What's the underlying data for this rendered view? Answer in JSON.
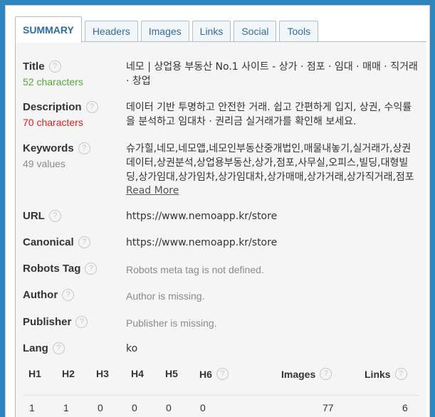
{
  "tabs": [
    "SUMMARY",
    "Headers",
    "Images",
    "Links",
    "Social",
    "Tools"
  ],
  "help_glyph": "?",
  "title": {
    "label": "Title",
    "sub": "52 characters",
    "value": "네모 | 상업용 부동산 No.1 사이트 - 상가 · 점포 · 임대 · 매매 · 직거래 · 창업"
  },
  "description": {
    "label": "Description",
    "sub": "70 characters",
    "value": "데이터 기반 투명하고 안전한 거래. 쉽고 간편하게 입지, 상권, 수익률을 분석하고 임대차 · 권리금 실거래가를 확인해 보세요."
  },
  "keywords": {
    "label": "Keywords",
    "sub": "49 values",
    "value": "슈가힐,네모,네모앱,네모인부동산중개법인,매물내놓기,실거래가,상권데이터,상권분석,상업용부동산,상가,점포,사무실,오피스,빌딩,대형빌딩,상가임대,상가임차,상가임대차,상가매매,상가거래,상가직거래,점포",
    "read_more": "Read More"
  },
  "url": {
    "label": "URL",
    "value": "https://www.nemoapp.kr/store"
  },
  "canonical": {
    "label": "Canonical",
    "value": "https://www.nemoapp.kr/store"
  },
  "robots": {
    "label": "Robots Tag",
    "value": "Robots meta tag is not defined."
  },
  "author": {
    "label": "Author",
    "value": "Author is missing."
  },
  "publisher": {
    "label": "Publisher",
    "value": "Publisher is missing."
  },
  "lang": {
    "label": "Lang",
    "value": "ko"
  },
  "stats": {
    "headers": [
      "H1",
      "H2",
      "H3",
      "H4",
      "H5",
      "H6",
      "Images",
      "Links"
    ],
    "values": [
      "1",
      "1",
      "0",
      "0",
      "0",
      "0",
      "77",
      "6"
    ]
  },
  "colors": {
    "accent": "#2e6da4",
    "frame": "#2f86bf",
    "ok": "#5ba63c",
    "warn": "#d9201c"
  }
}
